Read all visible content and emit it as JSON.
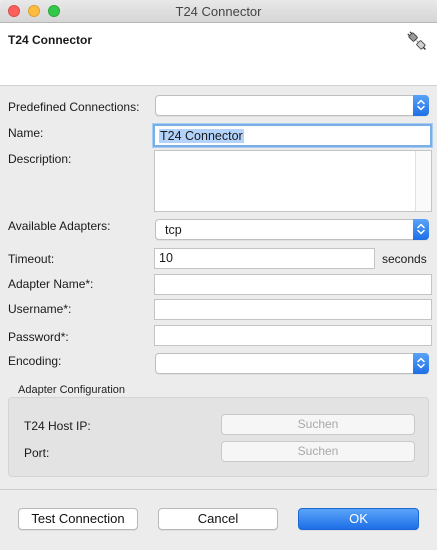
{
  "window": {
    "title": "T24 Connector"
  },
  "header": {
    "title": "T24 Connector",
    "icon": "plug-connector-icon"
  },
  "form": {
    "predefined_label": "Predefined Connections:",
    "predefined_value": "",
    "name_label": "Name:",
    "name_value": "T24 Connector",
    "description_label": "Description:",
    "description_value": "",
    "adapters_label": "Available Adapters:",
    "adapters_value": "tcp",
    "timeout_label": "Timeout:",
    "timeout_value": "10",
    "timeout_unit": "seconds",
    "adapter_name_label": "Adapter Name*:",
    "adapter_name_value": "",
    "username_label": "Username*:",
    "username_value": "",
    "password_label": "Password*:",
    "password_value": "",
    "encoding_label": "Encoding:",
    "encoding_value": ""
  },
  "adapter_config": {
    "title": "Adapter Configuration",
    "host_label": "T24 Host IP:",
    "host_button": "Suchen",
    "port_label": "Port:",
    "port_button": "Suchen"
  },
  "footer": {
    "test_label": "Test Connection",
    "cancel_label": "Cancel",
    "ok_label": "OK"
  },
  "colors": {
    "accent": "#1d6fe8",
    "close": "#fc605c",
    "minimize": "#fdbc40",
    "maximize": "#34c84a",
    "selection": "#b3d3fb"
  }
}
